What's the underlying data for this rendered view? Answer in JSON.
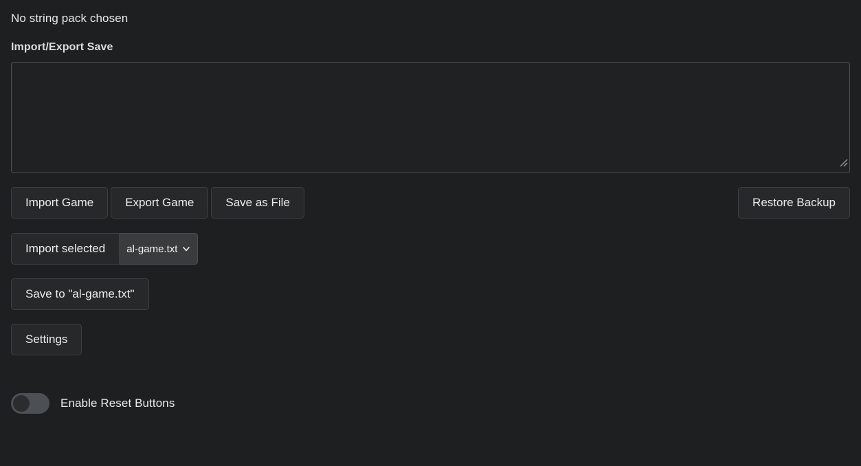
{
  "status": {
    "string_pack": "No string pack chosen"
  },
  "section": {
    "title": "Import/Export Save"
  },
  "save_area": {
    "value": "",
    "placeholder": ""
  },
  "actions": {
    "import_game": "Import Game",
    "export_game": "Export Game",
    "save_as_file": "Save as File",
    "restore_backup": "Restore Backup",
    "import_selected": "Import selected",
    "save_to_file": "Save to \"al-game.txt\"",
    "settings": "Settings"
  },
  "file_select": {
    "selected": "al-game.txt",
    "options": [
      "al-game.txt"
    ],
    "icon": "chevron-down-icon"
  },
  "reset_toggle": {
    "label": "Enable Reset Buttons",
    "state": "off"
  },
  "colors": {
    "background": "#1e1f20",
    "button_fill": "#272829",
    "button_border": "#3d3f42",
    "textarea_fill": "#202122",
    "textarea_border": "#4e5053",
    "select_fill": "#3a3b3d",
    "toggle_track": "#4c4f54",
    "toggle_knob": "#2b2c2e",
    "text": "#ededed"
  }
}
